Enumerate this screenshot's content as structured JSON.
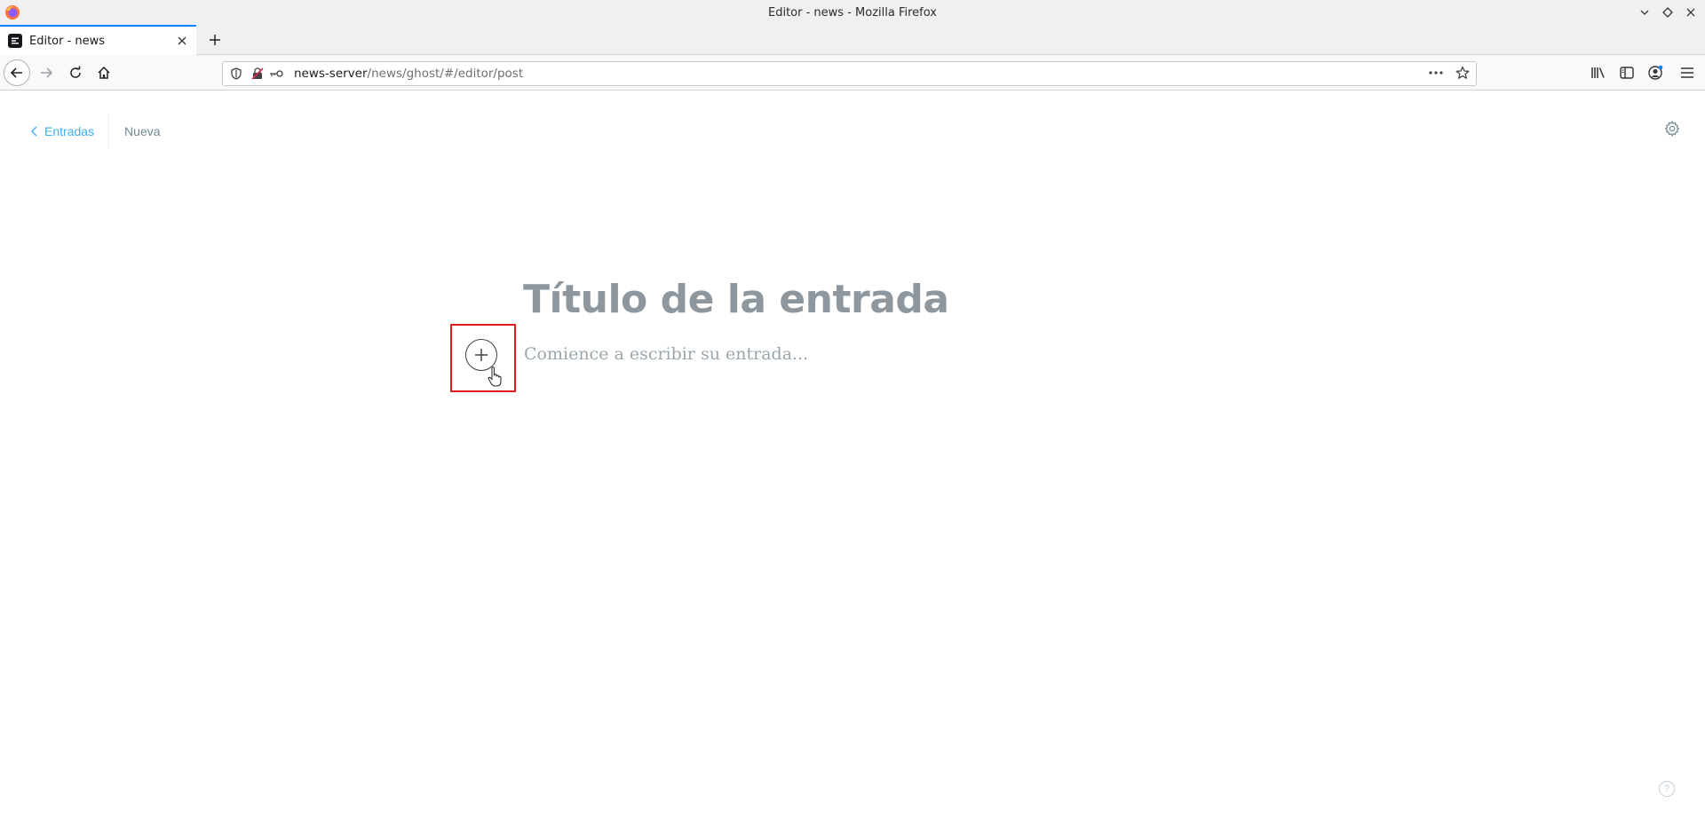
{
  "window": {
    "title": "Editor - news - Mozilla Firefox"
  },
  "tabs": [
    {
      "label": "Editor - news",
      "active": true
    }
  ],
  "navigation": {
    "url_host": "news-server",
    "url_path": "/news/ghost/#/editor/post"
  },
  "editor": {
    "breadcrumb_back_label": "Entradas",
    "status_label": "Nueva",
    "title_placeholder": "Título de la entrada",
    "body_placeholder": "Comience a escribir su entrada...",
    "help_label": "?"
  },
  "colors": {
    "accent": "#3eb0ef",
    "highlight": "#e01b1b",
    "tab_indicator": "#0a84ff"
  }
}
